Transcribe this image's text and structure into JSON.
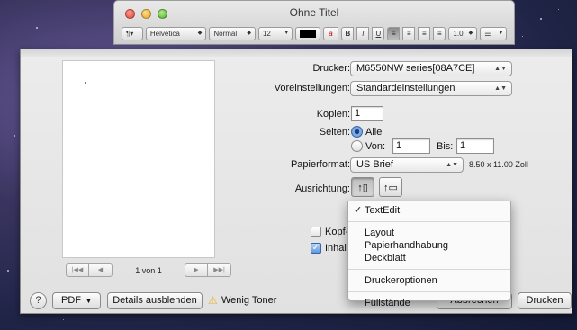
{
  "window": {
    "title": "Ohne Titel"
  },
  "format_bar": {
    "paragraph_label": "¶▾",
    "font_family": "Helvetica",
    "font_style": "Normal",
    "font_size": "12",
    "bold": "B",
    "italic": "I",
    "underline": "U",
    "line_spacing": "1.0"
  },
  "print": {
    "printer_label": "Drucker:",
    "printer_value": "M6550NW series[08A7CE]",
    "presets_label": "Voreinstellungen:",
    "presets_value": "Standardeinstellungen",
    "copies_label": "Kopien:",
    "copies_value": "1",
    "pages_label": "Seiten:",
    "pages_all": "Alle",
    "pages_from": "Von:",
    "pages_from_value": "1",
    "pages_to": "Bis:",
    "pages_to_value": "1",
    "paper_label": "Papierformat:",
    "paper_value": "US Brief",
    "paper_size": "8.50 x 11.00 Zoll",
    "orientation_label": "Ausrichtung:",
    "header_checkbox": "Kopf-",
    "content_checkbox": "Inhalt",
    "page_indicator": "1 von 1"
  },
  "menu": {
    "selected": "TextEdit",
    "items_group1": [
      "Layout",
      "Papierhandhabung",
      "Deckblatt"
    ],
    "item_printer_options": "Druckeroptionen",
    "item_levels": "Füllstände"
  },
  "bottom": {
    "help": "?",
    "pdf": "PDF",
    "details": "Details ausblenden",
    "warning": "Wenig Toner",
    "cancel": "Abbrechen",
    "print": "Drucken"
  }
}
